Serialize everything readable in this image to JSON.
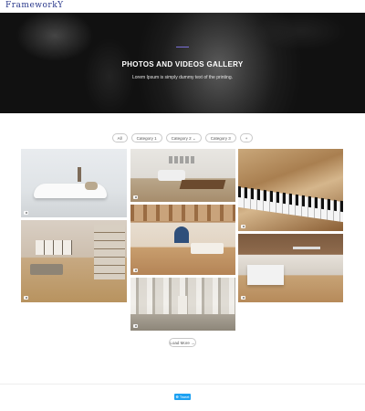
{
  "header": {
    "logo": "FrameworkY"
  },
  "hero": {
    "title": "PHOTOS AND VIDEOS GALLERY",
    "subtitle": "Lorem Ipsum is simply dummy text of the printing."
  },
  "filters": [
    "All",
    "Category 1",
    "Category 2 ⌄",
    "Category 3",
    "+"
  ],
  "gallery": {
    "items": [
      {
        "label": "white-lounge-chair-photo",
        "icon": "camera-icon"
      },
      {
        "label": "living-room-table-photo",
        "icon": "camera-icon"
      },
      {
        "label": "piano-keys-photo",
        "icon": "camera-icon"
      },
      {
        "label": "library-living-room-photo",
        "icon": "camera-icon"
      },
      {
        "label": "wooden-beam-room-photo",
        "icon": "camera-icon"
      },
      {
        "label": "modern-kitchen-photo",
        "icon": "camera-icon"
      },
      {
        "label": "colonnade-corridor-photo",
        "icon": "camera-icon"
      }
    ]
  },
  "load_more": "Load More →",
  "footer": {
    "tweet_label": "❁ Tweet"
  },
  "colors": {
    "accent": "#2b3a8c",
    "hero_line": "#7a6fd6",
    "tweet": "#1da1f2"
  }
}
